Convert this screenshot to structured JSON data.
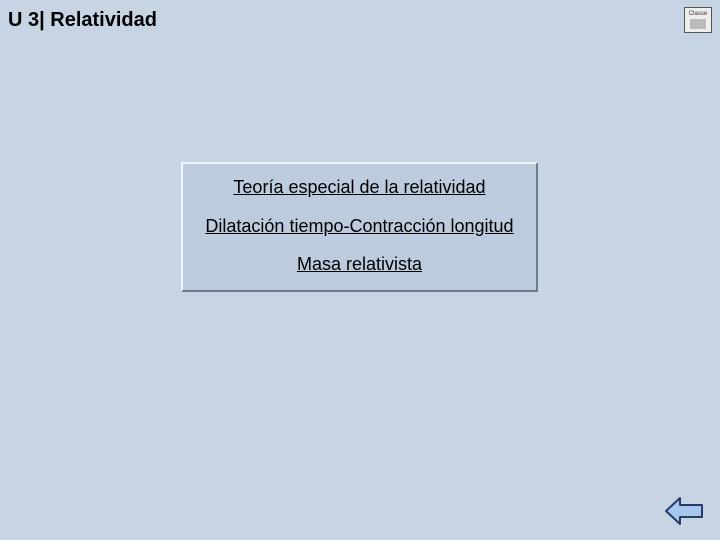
{
  "header": {
    "title": "U 3| Relatividad",
    "logo_text": "Classe"
  },
  "menu": {
    "items": [
      "Teoría especial de la relatividad",
      "Dilatación tiempo-Contracción longitud",
      "Masa relativista"
    ]
  },
  "nav": {
    "back_label": "back"
  },
  "colors": {
    "page_bg": "#c6d4e4",
    "box_bg": "#bccbde",
    "arrow_fill": "#a6c8ef",
    "arrow_stroke": "#2a3a66"
  }
}
